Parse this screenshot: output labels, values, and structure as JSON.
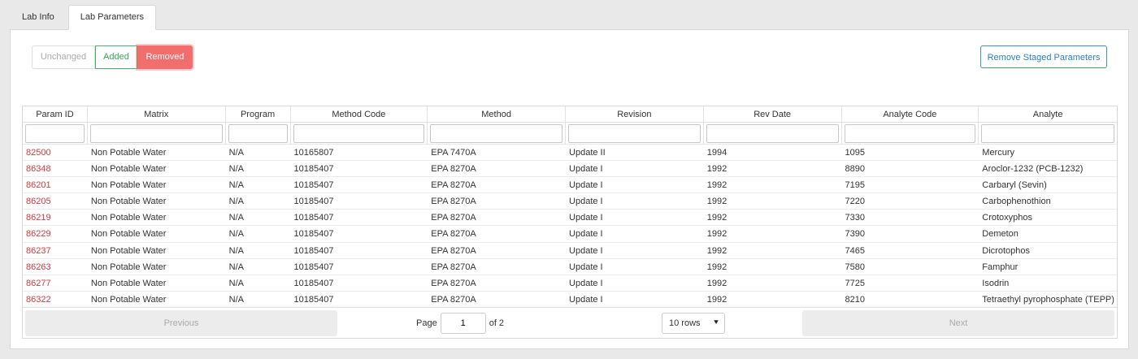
{
  "tabs": [
    {
      "label": "Lab Info"
    },
    {
      "label": "Lab Parameters"
    }
  ],
  "filters": {
    "unchanged": "Unchanged",
    "added": "Added",
    "removed": "Removed"
  },
  "remove_staged_label": "Remove Staged Parameters",
  "columns": [
    "Param ID",
    "Matrix",
    "Program",
    "Method Code",
    "Method",
    "Revision",
    "Rev Date",
    "Analyte Code",
    "Analyte"
  ],
  "rows": [
    [
      "82500",
      "Non Potable Water",
      "N/A",
      "10165807",
      "EPA 7470A",
      "Update II",
      "1994",
      "1095",
      "Mercury"
    ],
    [
      "86348",
      "Non Potable Water",
      "N/A",
      "10185407",
      "EPA 8270A",
      "Update I",
      "1992",
      "8890",
      "Aroclor-1232 (PCB-1232)"
    ],
    [
      "86201",
      "Non Potable Water",
      "N/A",
      "10185407",
      "EPA 8270A",
      "Update I",
      "1992",
      "7195",
      "Carbaryl (Sevin)"
    ],
    [
      "86205",
      "Non Potable Water",
      "N/A",
      "10185407",
      "EPA 8270A",
      "Update I",
      "1992",
      "7220",
      "Carbophenothion"
    ],
    [
      "86219",
      "Non Potable Water",
      "N/A",
      "10185407",
      "EPA 8270A",
      "Update I",
      "1992",
      "7330",
      "Crotoxyphos"
    ],
    [
      "86229",
      "Non Potable Water",
      "N/A",
      "10185407",
      "EPA 8270A",
      "Update I",
      "1992",
      "7390",
      "Demeton"
    ],
    [
      "86237",
      "Non Potable Water",
      "N/A",
      "10185407",
      "EPA 8270A",
      "Update I",
      "1992",
      "7465",
      "Dicrotophos"
    ],
    [
      "86263",
      "Non Potable Water",
      "N/A",
      "10185407",
      "EPA 8270A",
      "Update I",
      "1992",
      "7580",
      "Famphur"
    ],
    [
      "86277",
      "Non Potable Water",
      "N/A",
      "10185407",
      "EPA 8270A",
      "Update I",
      "1992",
      "7725",
      "Isodrin"
    ],
    [
      "86322",
      "Non Potable Water",
      "N/A",
      "10185407",
      "EPA 8270A",
      "Update I",
      "1992",
      "8210",
      "Tetraethyl pyrophosphate (TEPP)"
    ]
  ],
  "pagination": {
    "previous": "Previous",
    "next": "Next",
    "page_label": "Page",
    "page_value": "1",
    "of_label": "of 2",
    "rows_option": "10 rows"
  },
  "colors": {
    "param_id": "#d9383a",
    "removed_bg": "#f26d6d",
    "added": "#3aa55a",
    "primary": "#2a7fc0"
  }
}
